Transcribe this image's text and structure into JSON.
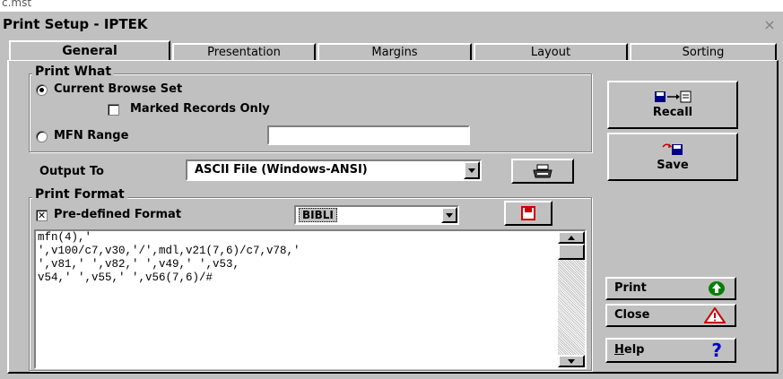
{
  "background_window_title": "c.mst",
  "dialog": {
    "title": "Print Setup - IPTEK",
    "close_glyph": "×"
  },
  "tabs": [
    "General",
    "Presentation",
    "Margins",
    "Layout",
    "Sorting"
  ],
  "print_what": {
    "label": "Print What",
    "current_browse_set": "Current Browse Set",
    "marked_records_only": "Marked Records Only",
    "mfn_range": "MFN Range",
    "mfn_range_value": ""
  },
  "output_to": {
    "label": "Output To",
    "selected": "ASCII File (Windows-ANSI)",
    "printer_icon": "printer-icon"
  },
  "print_format": {
    "label": "Print Format",
    "predefined_label": "Pre-defined Format",
    "predefined_checked_glyph": "✕",
    "format_selected": "BIBLI",
    "format_text": "mfn(4),'\n',v100/c7,v30,'/',mdl,v21(7,6)/c7,v78,'\n',v81,' ',v82,' ',v49,' ',v53,\nv54,' ',v55,' ',v56(7,6)/#"
  },
  "buttons": {
    "recall": "Recall",
    "save": "Save",
    "print": "Print",
    "close": "Close",
    "help_prefix": "H",
    "help_rest": "elp",
    "help_glyph": "?"
  },
  "colors": {
    "dialog_bg": "#c0c0c0",
    "print_icon_green": "#008000",
    "close_icon_red": "#cc0000",
    "help_icon_blue": "#0000cc"
  }
}
